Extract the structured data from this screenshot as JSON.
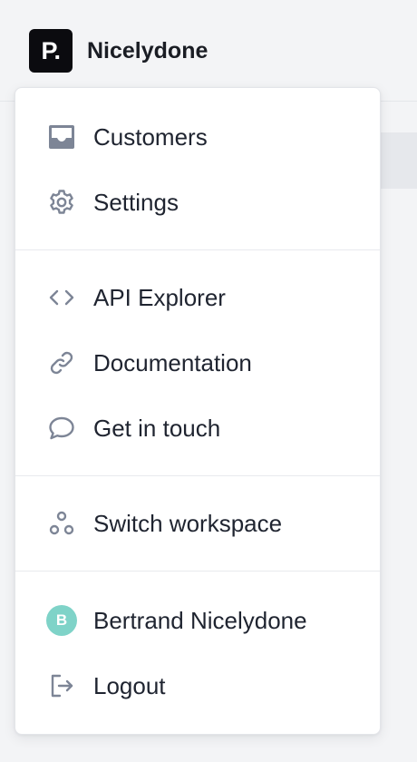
{
  "brand": {
    "logo_text": "P.",
    "name": "Nicelydone"
  },
  "menu": {
    "groups": [
      {
        "items": [
          {
            "label": "Customers",
            "icon": "inbox-icon"
          },
          {
            "label": "Settings",
            "icon": "gear-icon"
          }
        ]
      },
      {
        "items": [
          {
            "label": "API Explorer",
            "icon": "code-icon"
          },
          {
            "label": "Documentation",
            "icon": "link-icon"
          },
          {
            "label": "Get in touch",
            "icon": "chat-bubble-icon"
          }
        ]
      },
      {
        "items": [
          {
            "label": "Switch workspace",
            "icon": "workspaces-icon"
          }
        ]
      },
      {
        "items": [
          {
            "label": "Bertrand Nicelydone",
            "icon": "avatar",
            "avatar_initial": "B",
            "avatar_color": "#7fd3c8"
          },
          {
            "label": "Logout",
            "icon": "logout-icon"
          }
        ]
      }
    ]
  },
  "colors": {
    "icon": "#7d8596",
    "text": "#1f2430",
    "background": "#f3f4f6",
    "menu_background": "#ffffff"
  }
}
